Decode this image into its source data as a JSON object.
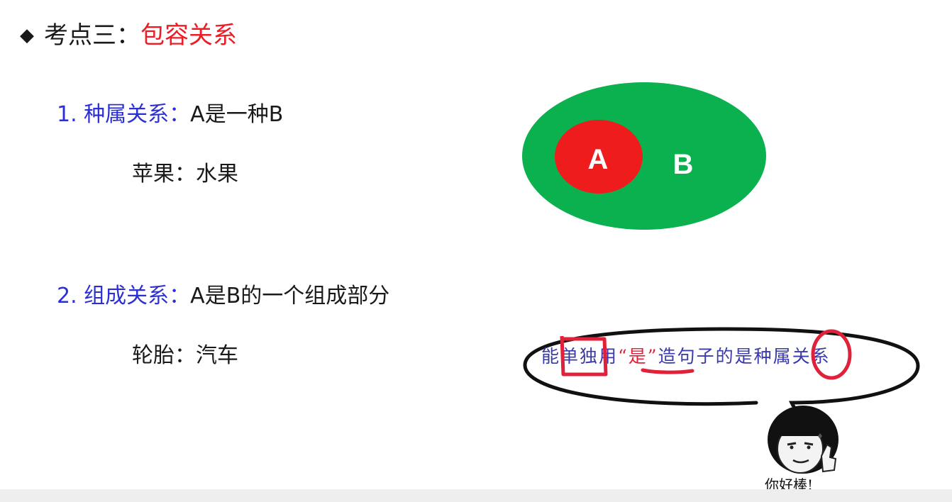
{
  "title": {
    "prefix": "考点三：",
    "topic": "包容关系"
  },
  "items": [
    {
      "label": "1. 种属关系：",
      "description": "A是一种B",
      "example": "苹果：水果"
    },
    {
      "label": "2. 组成关系：",
      "description": "A是B的一个组成部分",
      "example": "轮胎：汽车"
    }
  ],
  "venn": {
    "inner_label": "A",
    "outer_label": "B",
    "inner_color": "#ee1c1c",
    "outer_color": "#0cb14f"
  },
  "bubble": {
    "part1": "能单独用",
    "highlight": "“是”",
    "part2": "造句子的是种属关系"
  },
  "meme": {
    "caption": "你好棒!"
  },
  "colors": {
    "accent_red": "#ee1c25",
    "heading_blue": "#2b2fd6",
    "bubble_text": "#3a3aa8",
    "annotation_red": "#e0213a"
  }
}
